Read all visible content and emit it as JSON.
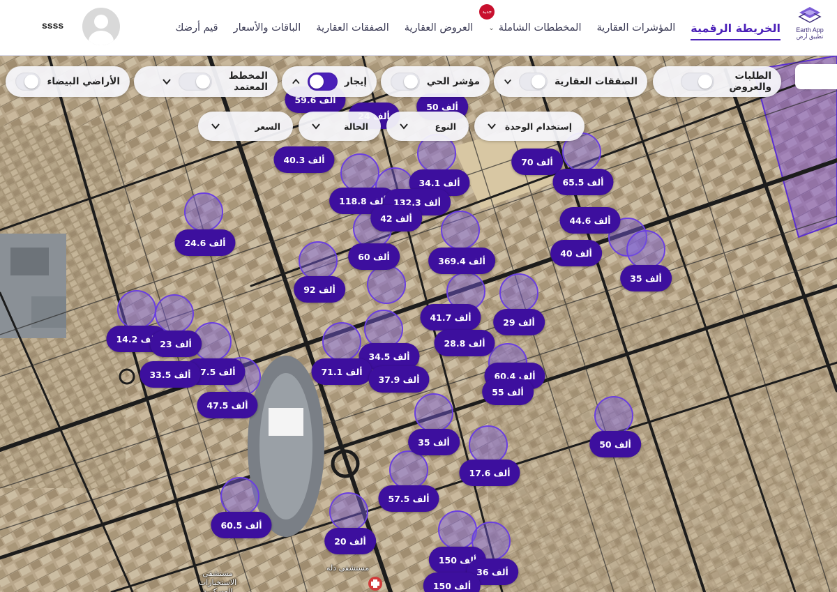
{
  "brand": {
    "name_en": "Earth App",
    "name_ar": "تطبيق أرض",
    "accent": "#4a1fb8"
  },
  "nav": {
    "items": [
      {
        "label": "الخريطة الرقمية",
        "active": true
      },
      {
        "label": "المؤشرات العقارية"
      },
      {
        "label": "المخططات الشاملة",
        "badge": "جديد",
        "dropdown": true
      },
      {
        "label": "العروض العقارية"
      },
      {
        "label": "الصفقات العقارية"
      },
      {
        "label": "الباقات والأسعار"
      },
      {
        "label": "قيم أرضك"
      }
    ]
  },
  "user": {
    "name": "ssss"
  },
  "filters": {
    "row1": [
      {
        "label": "الطلبات والعروض",
        "toggle": false
      },
      {
        "label": "الصفقات العقارية",
        "toggle": false,
        "chevron": "down"
      },
      {
        "label": "مؤشر الحي",
        "toggle": false
      },
      {
        "label": "إيجار",
        "toggle": true,
        "chevron": "up"
      },
      {
        "label": "المخطط المعتمد",
        "toggle": false,
        "chevron": "down"
      },
      {
        "label": "الأراضي البيضاء",
        "toggle": false
      }
    ],
    "row2": [
      {
        "label": "إستخدام الوحدة"
      },
      {
        "label": "النوع"
      },
      {
        "label": "الحالة"
      },
      {
        "label": "السعر"
      }
    ]
  },
  "markers": [
    {
      "label": "59.6 ألف"
    },
    {
      "label": "24 ألف"
    },
    {
      "label": "50 ألف"
    },
    {
      "label": "40.3 ألف"
    },
    {
      "label": "34.1 ألف"
    },
    {
      "label": "70 ألف"
    },
    {
      "label": "65.5 ألف"
    },
    {
      "label": "118.8 ألف"
    },
    {
      "label": "132.3 ألف"
    },
    {
      "label": "42 ألف"
    },
    {
      "label": "24.6 ألف"
    },
    {
      "label": "44.6 ألف"
    },
    {
      "label": "60 ألف"
    },
    {
      "label": "369.4 ألف"
    },
    {
      "label": "40 ألف"
    },
    {
      "label": "35 ألف"
    },
    {
      "label": "92 ألف"
    },
    {
      "label": "41.7 ألف"
    },
    {
      "label": "29 ألف"
    },
    {
      "label": "14.2 ألف"
    },
    {
      "label": "23 ألف"
    },
    {
      "label": "28.8 ألف"
    },
    {
      "label": "34.5 ألف"
    },
    {
      "label": "47.5 ألف"
    },
    {
      "label": "33.5 ألف"
    },
    {
      "label": "71.1 ألف"
    },
    {
      "label": "37.9 ألف"
    },
    {
      "label": "60.4 ألف"
    },
    {
      "label": "55 ألف"
    },
    {
      "label": "47.5 ألف"
    },
    {
      "label": "50 ألف"
    },
    {
      "label": "35 ألف"
    },
    {
      "label": "17.6 ألف"
    },
    {
      "label": "57.5 ألف"
    },
    {
      "label": "60.5 ألف"
    },
    {
      "label": "20 ألف"
    },
    {
      "label": "150 ألف"
    },
    {
      "label": "36 ألف"
    },
    {
      "label": "150 ألف"
    }
  ],
  "map_labels": [
    "مستشفى دله",
    "مستشفى الاستخبارات العسكرية"
  ]
}
